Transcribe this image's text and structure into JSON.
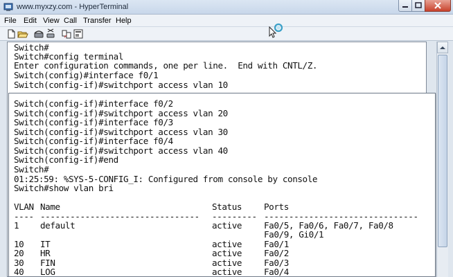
{
  "window": {
    "title": "www.myxzy.com - HyperTerminal",
    "icon": "terminal-app-icon"
  },
  "menu": {
    "items": [
      "File",
      "Edit",
      "View",
      "Call",
      "Transfer",
      "Help"
    ]
  },
  "toolbar": {
    "icons": [
      "new-icon",
      "open-icon",
      "phone-icon",
      "disconnect-icon",
      "send-icon",
      "properties-icon"
    ]
  },
  "terminal": {
    "background_lines": [
      "Switch#",
      "Switch#config terminal",
      "Enter configuration commands, one per line.  End with CNTL/Z.",
      "Switch(config)#interface f0/1",
      "Switch(config-if)#switchport access vlan 10"
    ],
    "front_lines": [
      "Switch(config-if)#interface f0/2",
      "Switch(config-if)#switchport access vlan 20",
      "Switch(config-if)#interface f0/3",
      "Switch(config-if)#switchport access vlan 30",
      "Switch(config-if)#interface f0/4",
      "Switch(config-if)#switchport access vlan 40",
      "Switch(config-if)#end",
      "Switch#",
      "01:25:59: %SYS-5-CONFIG_I: Configured from console by console",
      "Switch#show vlan bri"
    ],
    "vlan_table": {
      "headers": {
        "vlan": "VLAN",
        "name": "Name",
        "status": "Status",
        "ports": "Ports"
      },
      "separators": {
        "vlan": "----",
        "name": "--------------------------------",
        "status": "---------",
        "ports": "-------------------------------"
      },
      "rows": [
        {
          "vlan": "1",
          "name": "default",
          "status": "active",
          "ports": "Fa0/5, Fa0/6, Fa0/7, Fa0/8",
          "ports2": "Fa0/9, Gi0/1"
        },
        {
          "vlan": "10",
          "name": "IT",
          "status": "active",
          "ports": "Fa0/1"
        },
        {
          "vlan": "20",
          "name": "HR",
          "status": "active",
          "ports": "Fa0/2"
        },
        {
          "vlan": "30",
          "name": "FIN",
          "status": "active",
          "ports": "Fa0/3"
        },
        {
          "vlan": "40",
          "name": "LOG",
          "status": "active",
          "ports": "Fa0/4"
        }
      ]
    }
  }
}
